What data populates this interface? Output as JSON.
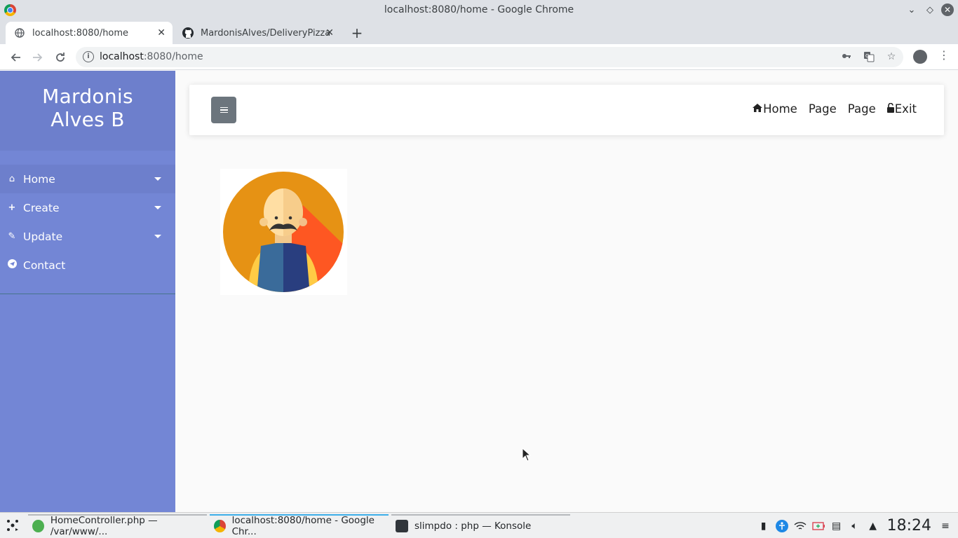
{
  "window": {
    "title": "localhost:8080/home - Google Chrome",
    "controls": [
      "chevron-down-icon",
      "diamond-icon",
      "close-icon"
    ]
  },
  "tabs": [
    {
      "label": "localhost:8080/home",
      "icon": "globe-icon",
      "active": true
    },
    {
      "label": "MardonisAlves/DeliveryPizza",
      "icon": "github-icon",
      "active": false
    }
  ],
  "toolbar": {
    "url_host": "localhost",
    "url_rest": ":8080/home",
    "icons": [
      "back-icon",
      "forward-icon",
      "reload-icon",
      "key-icon",
      "translate-icon",
      "star-icon",
      "profile-icon",
      "menu-icon"
    ]
  },
  "sidebar": {
    "title": "Mardonis Alves B",
    "items": [
      {
        "label": "Home",
        "icon": "home-icon",
        "dropdown": true,
        "active": true
      },
      {
        "label": "Create",
        "icon": "plus-icon",
        "dropdown": true,
        "active": false
      },
      {
        "label": "Update",
        "icon": "edit-icon",
        "dropdown": true,
        "active": false
      },
      {
        "label": "Contact",
        "icon": "paper-plane-icon",
        "dropdown": false,
        "active": false
      }
    ]
  },
  "navbar": {
    "links": [
      {
        "label": "Home",
        "icon": "home-icon"
      },
      {
        "label": "Page"
      },
      {
        "label": "Page"
      },
      {
        "label": "Exit",
        "icon": "unlock-icon"
      }
    ]
  },
  "taskbar": {
    "tasks": [
      {
        "label": "HomeController.php — /var/www/...",
        "icon": "editor-icon"
      },
      {
        "label": "localhost:8080/home - Google Chr...",
        "icon": "chrome-icon",
        "active": true
      },
      {
        "label": "slimpdo : php — Konsole",
        "icon": "terminal-icon"
      }
    ],
    "clock": "18:24"
  },
  "colors": {
    "sidebar": "#7386d5",
    "sidebar_dark": "#6d7fcc",
    "toggle_button": "#6c757d",
    "avatar_bg": "#e69214"
  }
}
